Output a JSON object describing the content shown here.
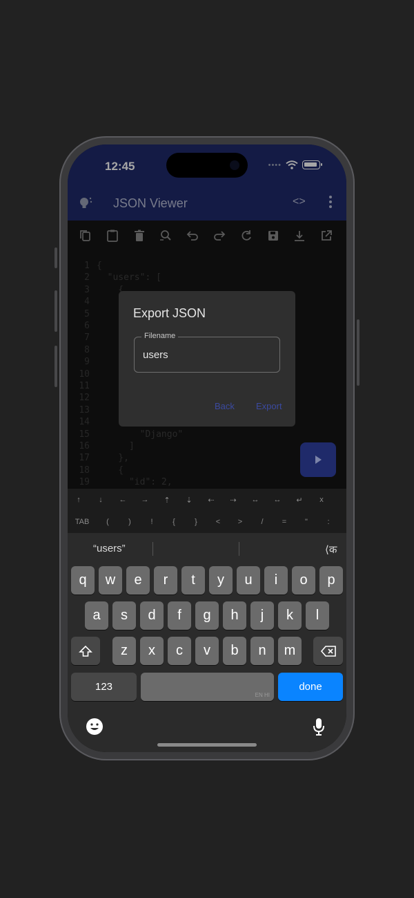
{
  "status": {
    "time": "12:45"
  },
  "app": {
    "title": "JSON Viewer",
    "code_icon": "<>"
  },
  "toolbar": {
    "tools": [
      "copy-icon",
      "paste-icon",
      "delete-icon",
      "search-replace-icon",
      "undo-icon",
      "redo-icon",
      "refresh-icon",
      "save-icon",
      "download-icon",
      "open-external-icon"
    ]
  },
  "editor": {
    "lines": [
      {
        "n": "1",
        "text": "{"
      },
      {
        "n": "2",
        "text": "  \"users\": ["
      },
      {
        "n": "3",
        "text": "    {"
      },
      {
        "n": "4",
        "text": "      \""
      },
      {
        "n": "5",
        "text": "      \""
      },
      {
        "n": "6",
        "text": "      \""
      },
      {
        "n": "7",
        "text": "      \""
      },
      {
        "n": "8",
        "text": "      \""
      },
      {
        "n": "9",
        "text": ""
      },
      {
        "n": "10",
        "text": ""
      },
      {
        "n": "11",
        "text": "      }"
      },
      {
        "n": "12",
        "text": "      \""
      },
      {
        "n": "13",
        "text": ""
      },
      {
        "n": "14",
        "text": ""
      },
      {
        "n": "15",
        "text": "        \"Django\""
      },
      {
        "n": "16",
        "text": "      ]"
      },
      {
        "n": "17",
        "text": "    },"
      },
      {
        "n": "18",
        "text": "    {"
      },
      {
        "n": "19",
        "text": "      \"id\": 2,"
      }
    ]
  },
  "dialog": {
    "title": "Export JSON",
    "field_label": "Filename",
    "field_value": "users",
    "back": "Back",
    "export": "Export"
  },
  "symbols_row1": [
    "↑",
    "↓",
    "←",
    "→",
    "⇡",
    "⇣",
    "⇠",
    "⇢",
    "↔",
    "↔",
    "↵",
    "x"
  ],
  "symbols_row2": [
    "TAB",
    "(",
    ")",
    "!",
    "{",
    "}",
    "<",
    ">",
    "/",
    "=",
    "\"",
    ":"
  ],
  "keyboard": {
    "suggestion": "“users”",
    "lang_switch": "⟨क",
    "row1": [
      "q",
      "w",
      "e",
      "r",
      "t",
      "y",
      "u",
      "i",
      "o",
      "p"
    ],
    "row2": [
      "a",
      "s",
      "d",
      "f",
      "g",
      "h",
      "j",
      "k",
      "l"
    ],
    "row3": [
      "z",
      "x",
      "c",
      "v",
      "b",
      "n",
      "m"
    ],
    "numbers": "123",
    "space_hint": "EN HI",
    "done": "done"
  }
}
